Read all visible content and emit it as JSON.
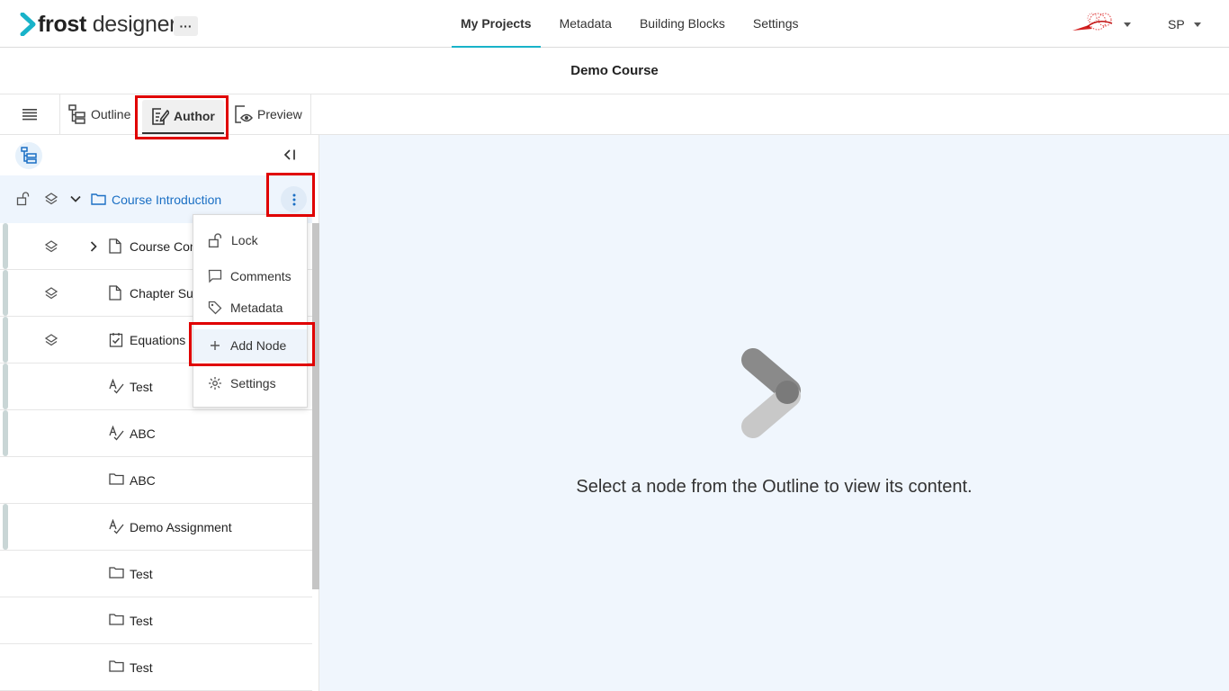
{
  "brand": {
    "name_bold": "frost",
    "name_light": " designer",
    "accent": "#19b3c9"
  },
  "header": {
    "more_label": "···",
    "nav": [
      {
        "label": "My Projects",
        "active": true
      },
      {
        "label": "Metadata",
        "active": false
      },
      {
        "label": "Building Blocks",
        "active": false
      },
      {
        "label": "Settings",
        "active": false
      }
    ],
    "user_initials": "SP"
  },
  "course": {
    "title": "Demo Course"
  },
  "modes": {
    "outline": "Outline",
    "author": "Author",
    "preview": "Preview",
    "active": "Author"
  },
  "tree": {
    "root": {
      "label": "Course Introduction",
      "icon": "folder-icon",
      "expanded": true
    },
    "nodes": [
      {
        "label": "Course Con",
        "icon": "page-icon",
        "layers": true,
        "expandable": true
      },
      {
        "label": "Chapter Su",
        "icon": "page-icon",
        "layers": true,
        "expandable": false
      },
      {
        "label": "Equations",
        "icon": "checklist-icon",
        "layers": true,
        "expandable": false
      },
      {
        "label": "Test",
        "icon": "assignment-icon",
        "layers": false,
        "expandable": false
      },
      {
        "label": "ABC",
        "icon": "assignment-icon",
        "layers": false,
        "expandable": false
      },
      {
        "label": "ABC",
        "icon": "folder-icon",
        "layers": false,
        "expandable": false
      },
      {
        "label": "Demo Assignment",
        "icon": "assignment-icon",
        "layers": false,
        "expandable": false
      },
      {
        "label": "Test",
        "icon": "folder-icon",
        "layers": false,
        "expandable": false
      },
      {
        "label": "Test",
        "icon": "folder-icon",
        "layers": false,
        "expandable": false
      },
      {
        "label": "Test",
        "icon": "folder-icon",
        "layers": false,
        "expandable": false
      }
    ]
  },
  "context_menu": {
    "items": [
      {
        "label": "Lock",
        "icon": "lock-icon"
      },
      {
        "label": "Comments",
        "icon": "comment-icon"
      },
      {
        "label": "Metadata",
        "icon": "tag-icon"
      },
      {
        "label": "Add Node",
        "icon": "plus-icon"
      },
      {
        "label": "Settings",
        "icon": "gear-icon"
      }
    ]
  },
  "main": {
    "empty_message": "Select a node from the Outline to view its content."
  },
  "colors": {
    "highlight": "#e00000",
    "link": "#1a6fc4",
    "main_bg": "#f0f6fd"
  }
}
